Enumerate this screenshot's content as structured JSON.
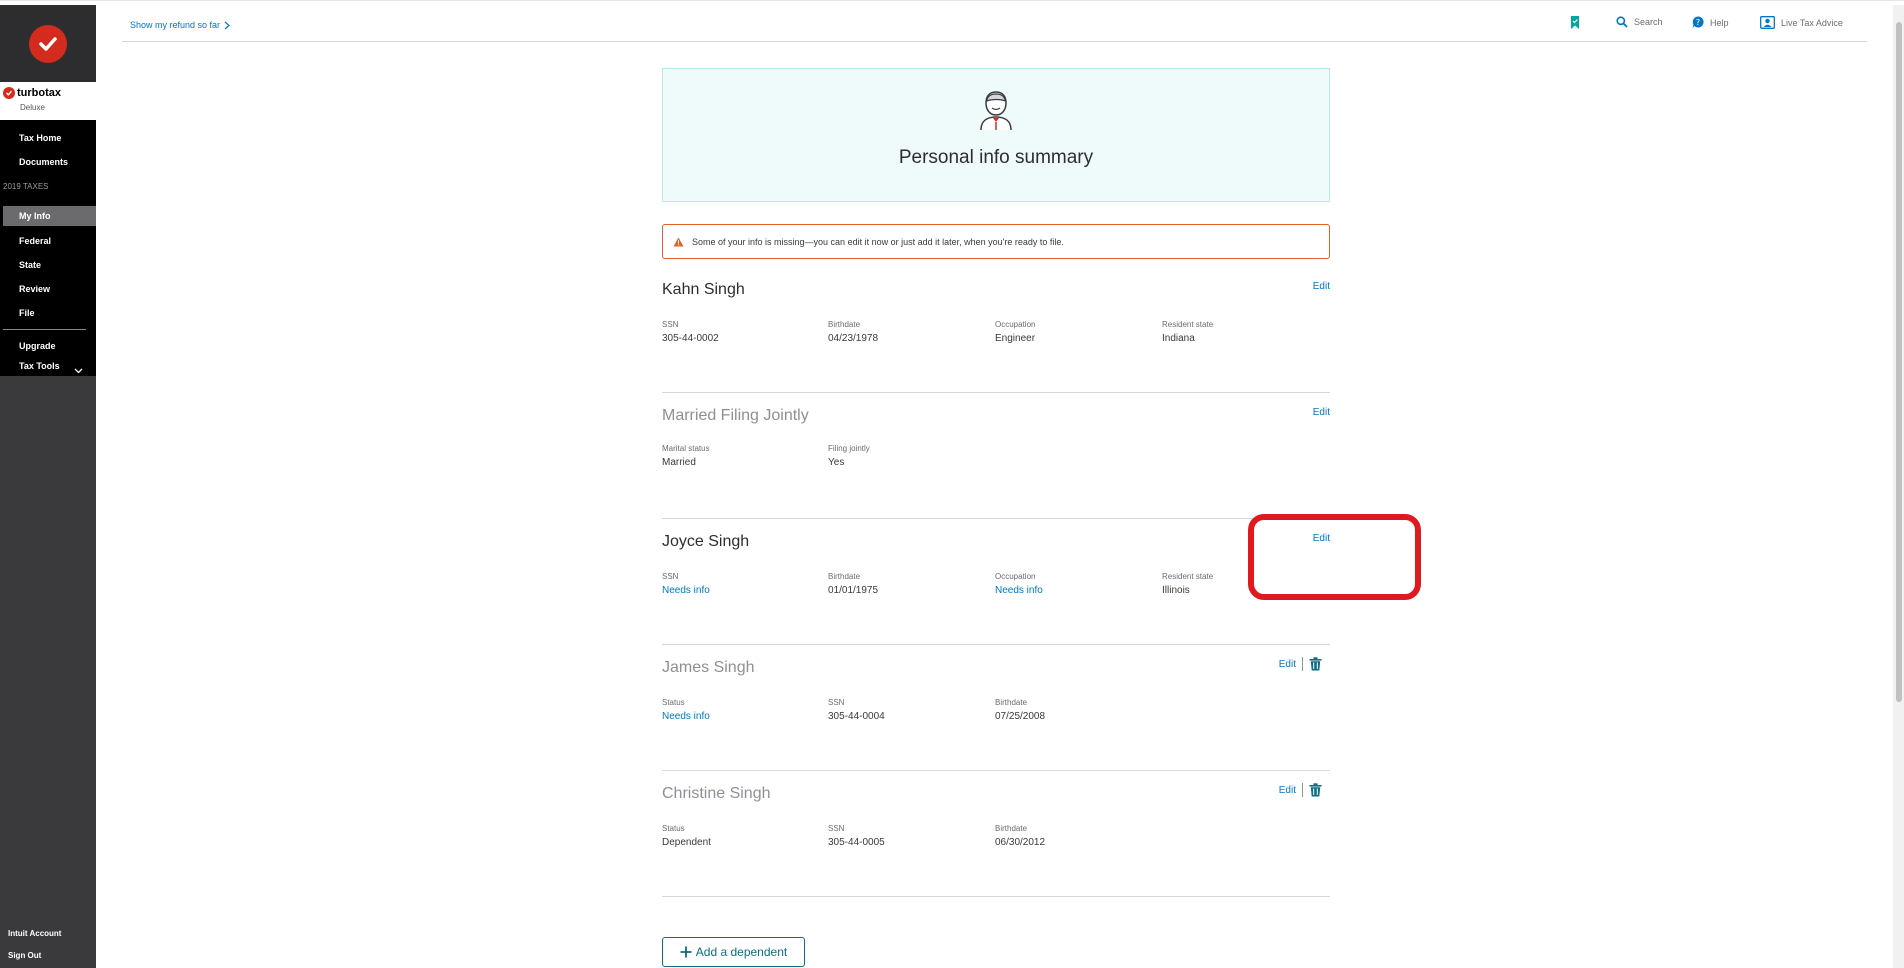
{
  "sidebar": {
    "brand_name": "turbotax",
    "brand_edition": "Deluxe",
    "nav": {
      "tax_home": "Tax Home",
      "documents": "Documents",
      "section_label": "2019 TAXES",
      "my_info": "My Info",
      "federal": "Federal",
      "state": "State",
      "review": "Review",
      "file": "File",
      "upgrade": "Upgrade",
      "tax_tools": "Tax Tools"
    },
    "bottom": {
      "intuit_account": "Intuit Account",
      "sign_out": "Sign Out"
    }
  },
  "topbar": {
    "refund_link": "Show my refund so far",
    "search": "Search",
    "help": "Help",
    "live_advice": "Live Tax Advice"
  },
  "hero": {
    "title": "Personal info summary"
  },
  "alert": {
    "text": "Some of your info is missing—you can edit it now or just add it later, when you're ready to file."
  },
  "sections": {
    "taxpayer": {
      "name": "Kahn Singh",
      "edit": "Edit",
      "fields": [
        {
          "label": "SSN",
          "value": "305-44-0002"
        },
        {
          "label": "Birthdate",
          "value": "04/23/1978"
        },
        {
          "label": "Occupation",
          "value": "Engineer"
        },
        {
          "label": "Resident state",
          "value": "Indiana"
        }
      ]
    },
    "filing": {
      "name": "Married Filing Jointly",
      "edit": "Edit",
      "fields": [
        {
          "label": "Marital status",
          "value": "Married"
        },
        {
          "label": "Filing jointly",
          "value": "Yes"
        }
      ]
    },
    "spouse": {
      "name": "Joyce Singh",
      "edit": "Edit",
      "fields": [
        {
          "label": "SSN",
          "value": "Needs info"
        },
        {
          "label": "Birthdate",
          "value": "01/01/1975"
        },
        {
          "label": "Occupation",
          "value": "Needs info"
        },
        {
          "label": "Resident state",
          "value": "Illinois"
        }
      ]
    },
    "dependent1": {
      "name": "James Singh",
      "edit": "Edit",
      "fields": [
        {
          "label": "Status",
          "value": "Needs info"
        },
        {
          "label": "SSN",
          "value": "305-44-0004"
        },
        {
          "label": "Birthdate",
          "value": "07/25/2008"
        }
      ]
    },
    "dependent2": {
      "name": "Christine Singh",
      "edit": "Edit",
      "fields": [
        {
          "label": "Status",
          "value": "Dependent"
        },
        {
          "label": "SSN",
          "value": "305-44-0005"
        },
        {
          "label": "Birthdate",
          "value": "06/30/2012"
        }
      ]
    }
  },
  "add_dependent": "Add a dependent",
  "colors": {
    "link": "#0077c5",
    "alert_border": "#e2612b",
    "brand_red": "#d52b1e",
    "highlight": "#e0191f",
    "teal": "#0d6d83"
  }
}
